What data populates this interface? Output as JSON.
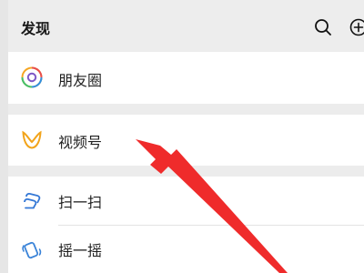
{
  "header": {
    "title": "发现"
  },
  "menu": [
    {
      "label": "朋友圈",
      "icon": "moments-icon"
    },
    {
      "label": "视频号",
      "icon": "channels-icon"
    },
    {
      "label": "扫一扫",
      "icon": "scan-icon"
    },
    {
      "label": "摇一摇",
      "icon": "shake-icon"
    }
  ],
  "colors": {
    "background": "#ececec",
    "cell": "#ffffff",
    "text": "#1f1f1f",
    "arrow": "#ef2b2b"
  }
}
